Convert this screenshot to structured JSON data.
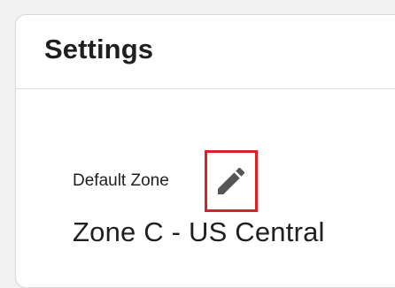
{
  "settings": {
    "title": "Settings",
    "default_zone": {
      "label": "Default Zone",
      "value": "Zone C - US Central",
      "edit_icon": "pencil-icon"
    }
  },
  "colors": {
    "page_background": "#f2f2f2",
    "card_background": "#ffffff",
    "text": "#1f1f1f",
    "icon": "#555555",
    "highlight_border": "#e01e25"
  }
}
